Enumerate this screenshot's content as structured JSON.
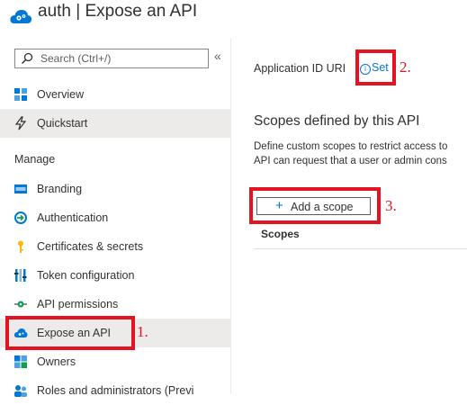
{
  "header": {
    "title": "auth | Expose an API",
    "app_icon": "cloud-gear-icon"
  },
  "sidebar": {
    "search_placeholder": "Search (Ctrl+/)",
    "collapse_glyph": "«",
    "items_top": [
      {
        "label": "Overview",
        "icon": "overview-icon"
      },
      {
        "label": "Quickstart",
        "icon": "quickstart-icon"
      }
    ],
    "section": "Manage",
    "items": [
      {
        "label": "Branding",
        "icon": "branding-icon"
      },
      {
        "label": "Authentication",
        "icon": "authentication-icon"
      },
      {
        "label": "Certificates & secrets",
        "icon": "key-icon"
      },
      {
        "label": "Token configuration",
        "icon": "token-icon"
      },
      {
        "label": "API permissions",
        "icon": "api-permissions-icon"
      },
      {
        "label": "Expose an API",
        "icon": "cloud-icon"
      },
      {
        "label": "Owners",
        "icon": "owners-icon"
      },
      {
        "label": "Roles and administrators (Previ",
        "icon": "roles-icon"
      }
    ]
  },
  "main": {
    "app_id_label": "Application ID URI",
    "info_glyph": "i",
    "set_link": "Set",
    "scopes_heading": "Scopes defined by this API",
    "description_line1": "Define custom scopes to restrict access to",
    "description_line2": "API can request that a user or admin cons",
    "add_scope_plus": "+",
    "add_scope_label": "Add a scope",
    "scopes_column": "Scopes"
  },
  "callouts": [
    "1.",
    "2.",
    "3."
  ],
  "colors": {
    "accent": "#0078d4",
    "callout": "#e3141f",
    "active_bg": "#edebe9"
  }
}
